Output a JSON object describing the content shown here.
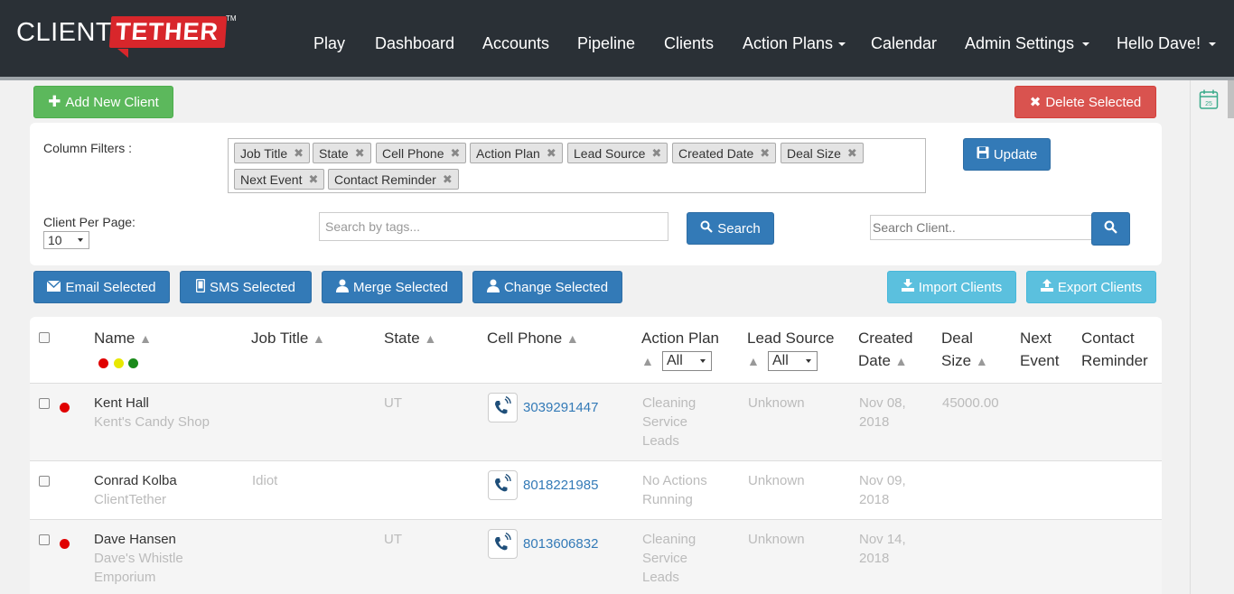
{
  "brand": {
    "client": "CLIENT",
    "tether": "TETHER",
    "tm": "TM",
    "colors": {
      "nav_bg": "#2a3036",
      "brand_red": "#d8262b"
    }
  },
  "nav": {
    "play": "Play",
    "dashboard": "Dashboard",
    "accounts": "Accounts",
    "pipeline": "Pipeline",
    "clients": "Clients",
    "action_plans": "Action Plans",
    "calendar": "Calendar",
    "admin_settings": "Admin Settings",
    "hello": "Hello Dave!"
  },
  "toolbar": {
    "add_new_client": "Add New Client",
    "delete_selected": "Delete Selected"
  },
  "filters": {
    "column_filters_label": "Column Filters :",
    "tags": [
      "Job Title",
      "State",
      "Cell Phone",
      "Action Plan",
      "Lead Source",
      "Created Date",
      "Deal Size",
      "Next Event",
      "Contact Reminder"
    ],
    "update": "Update",
    "per_page_label": "Client Per Page:",
    "per_page_value": "10",
    "tag_search_placeholder": "Search by tags...",
    "search": "Search",
    "client_search_placeholder": "Search Client.."
  },
  "actions": {
    "email_selected": "Email Selected",
    "sms_selected": "SMS Selected",
    "merge_selected": "Merge Selected",
    "change_selected": "Change Selected",
    "import_clients": "Import Clients",
    "export_clients": "Export Clients"
  },
  "table": {
    "headers": {
      "name": "Name",
      "job_title": "Job Title",
      "state": "State",
      "cell_phone": "Cell Phone",
      "action_plan": "Action Plan",
      "lead_source": "Lead Source",
      "created": "Created",
      "date": "Date",
      "deal": "Deal",
      "size": "Size",
      "next": "Next",
      "event": "Event",
      "contact": "Contact",
      "reminder": "Reminder",
      "all": "All",
      "sort_arrow": "▲"
    },
    "status_colors": [
      "#e00000",
      "#e8e800",
      "#1a8a1a"
    ],
    "rows": [
      {
        "name": "Kent Hall",
        "company": "Kent's Candy Shop",
        "job_title": "",
        "state": "UT",
        "phone": "3039291447",
        "action_plan": [
          "Cleaning",
          "Service",
          "Leads"
        ],
        "lead_source": "Unknown",
        "created": [
          "Nov 08,",
          "2018"
        ],
        "deal_size": "45000.00",
        "status": "red"
      },
      {
        "name": "Conrad Kolba",
        "company": "ClientTether",
        "job_title": "Idiot",
        "state": "",
        "phone": "8018221985",
        "action_plan": [
          "No Actions",
          "Running"
        ],
        "lead_source": "Unknown",
        "created": [
          "Nov 09,",
          "2018"
        ],
        "deal_size": "",
        "status": ""
      },
      {
        "name": "Dave Hansen",
        "company": [
          "Dave's Whistle",
          "Emporium"
        ],
        "job_title": "",
        "state": "UT",
        "phone": "8013606832",
        "action_plan": [
          "Cleaning",
          "Service",
          "Leads"
        ],
        "lead_source": "Unknown",
        "created": [
          "Nov 14,",
          "2018"
        ],
        "deal_size": "",
        "status": "red"
      }
    ]
  }
}
